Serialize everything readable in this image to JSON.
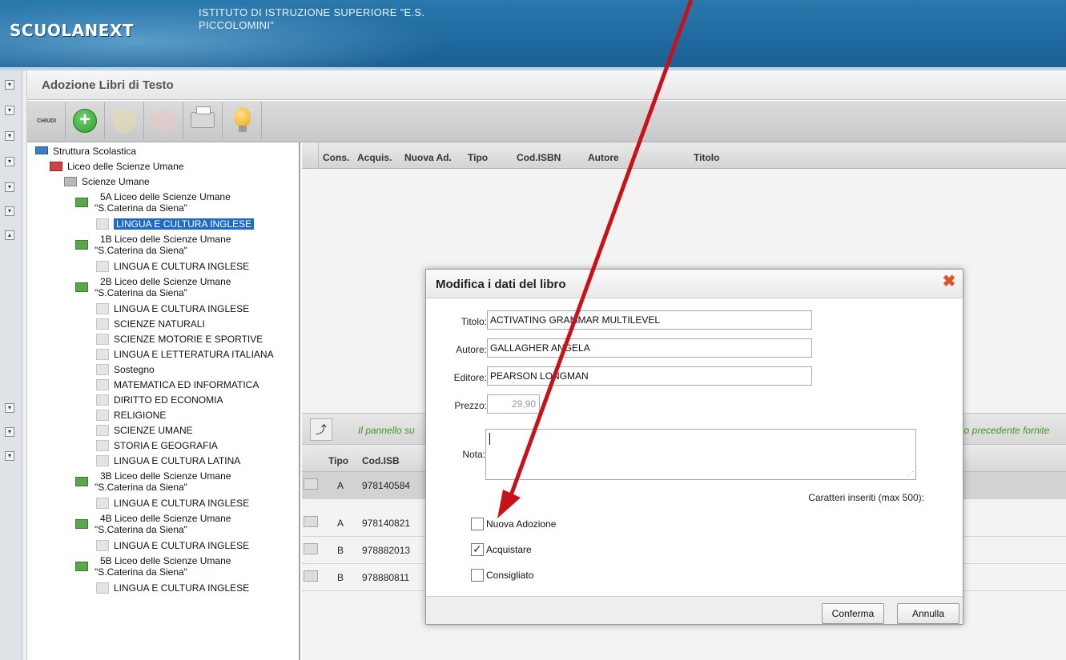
{
  "header": {
    "logo": "SCUOLANEXT",
    "school_name": "ISTITUTO DI ISTRUZIONE SUPERIORE \"E.S. PICCOLOMINI\""
  },
  "page": {
    "title": "Adozione Libri di Testo"
  },
  "toolbar": {
    "close_label": "CHIUDI",
    "buttons": [
      "add-icon",
      "edit-icon",
      "delete-icon",
      "print-icon",
      "bulb-icon"
    ]
  },
  "tree": {
    "root": "Struttura Scolastica",
    "school": "Liceo delle Scienze Umane",
    "branch": "Scienze Umane",
    "items": [
      {
        "type": "class",
        "l1": "5A Liceo delle Scienze Umane",
        "l2": "\"S.Caterina da Siena\""
      },
      {
        "type": "subject",
        "label": "LINGUA E CULTURA INGLESE",
        "selected": true
      },
      {
        "type": "class",
        "l1": "1B Liceo delle Scienze Umane",
        "l2": "\"S.Caterina da Siena\""
      },
      {
        "type": "subject",
        "label": "LINGUA E CULTURA INGLESE"
      },
      {
        "type": "class",
        "l1": "2B Liceo delle Scienze Umane",
        "l2": "\"S.Caterina da Siena\""
      },
      {
        "type": "subject",
        "label": "LINGUA E CULTURA INGLESE"
      },
      {
        "type": "subject",
        "label": "SCIENZE NATURALI"
      },
      {
        "type": "subject",
        "label": "SCIENZE MOTORIE E SPORTIVE"
      },
      {
        "type": "subject",
        "label": "LINGUA E LETTERATURA ITALIANA"
      },
      {
        "type": "subject",
        "label": "Sostegno"
      },
      {
        "type": "subject",
        "label": "MATEMATICA ED INFORMATICA"
      },
      {
        "type": "subject",
        "label": "DIRITTO ED ECONOMIA"
      },
      {
        "type": "subject",
        "label": "RELIGIONE"
      },
      {
        "type": "subject",
        "label": "SCIENZE UMANE"
      },
      {
        "type": "subject",
        "label": "STORIA E GEOGRAFIA"
      },
      {
        "type": "subject",
        "label": "LINGUA E CULTURA LATINA"
      },
      {
        "type": "class",
        "l1": "3B Liceo delle Scienze Umane",
        "l2": "\"S.Caterina da Siena\""
      },
      {
        "type": "subject",
        "label": "LINGUA E CULTURA INGLESE"
      },
      {
        "type": "class",
        "l1": "4B Liceo delle Scienze Umane",
        "l2": "\"S.Caterina da Siena\""
      },
      {
        "type": "subject",
        "label": "LINGUA E CULTURA INGLESE"
      },
      {
        "type": "class",
        "l1": "5B Liceo delle Scienze Umane",
        "l2": "\"S.Caterina da Siena\""
      },
      {
        "type": "subject",
        "label": "LINGUA E CULTURA INGLESE"
      }
    ]
  },
  "grid": {
    "columns": [
      "Cons.",
      "Acquis.",
      "Nuova Ad.",
      "Tipo",
      "Cod.ISBN",
      "Autore",
      "Titolo"
    ]
  },
  "info_bar": {
    "left_text": "Il pannello su",
    "right_text": "no precedente fornite"
  },
  "grid2": {
    "columns": [
      "Tipo",
      "Cod.ISB"
    ],
    "rows": [
      {
        "tipo": "A",
        "isbn": "978140584",
        "highlighted": true
      },
      {
        "tipo": "A",
        "isbn": "978140821"
      },
      {
        "tipo": "B",
        "isbn": "978882013"
      },
      {
        "tipo": "B",
        "isbn": "978880811"
      }
    ]
  },
  "modal": {
    "title": "Modifica i dati del libro",
    "fields": {
      "titolo_label": "Titolo:",
      "titolo_value": "ACTIVATING GRAMMAR MULTILEVEL",
      "autore_label": "Autore:",
      "autore_value": "GALLAGHER ANGELA",
      "editore_label": "Editore:",
      "editore_value": "PEARSON LONGMAN",
      "prezzo_label": "Prezzo:",
      "prezzo_value": "29,90",
      "nota_label": "Nota:",
      "nota_value": ""
    },
    "char_count_label": "Caratteri inseriti (max 500):",
    "checkboxes": [
      {
        "label": "Nuova Adozione",
        "checked": false
      },
      {
        "label": "Acquistare",
        "checked": true
      },
      {
        "label": "Consigliato",
        "checked": false
      }
    ],
    "confirm_label": "Conferma",
    "cancel_label": "Annulla"
  },
  "colors": {
    "header_blue": "#1f6aa0",
    "selection_blue": "#1e6bc7",
    "annotation_red": "#c8121a",
    "info_green": "#3f9a23"
  }
}
